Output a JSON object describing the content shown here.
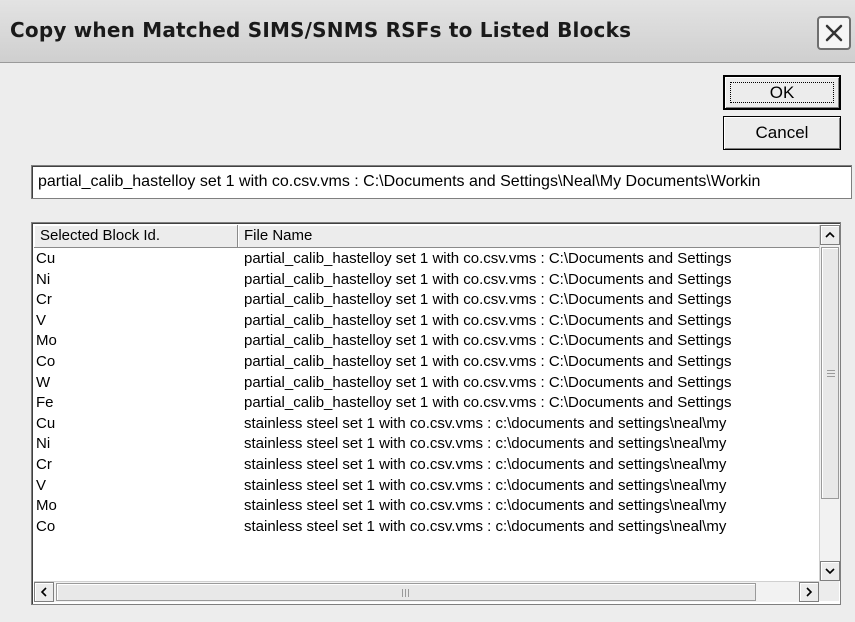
{
  "window": {
    "title": "Copy when Matched SIMS/SNMS RSFs to Listed Blocks"
  },
  "buttons": {
    "ok_label": "OK",
    "cancel_label": "Cancel"
  },
  "path_field": {
    "value": "partial_calib_hastelloy set 1 with co.csv.vms : C:\\Documents and Settings\\Neal\\My Documents\\Workin"
  },
  "list": {
    "columns": [
      "Selected Block Id.",
      "File Name"
    ],
    "rows": [
      {
        "block": "Cu",
        "file": "partial_calib_hastelloy set 1 with co.csv.vms : C:\\Documents and Settings"
      },
      {
        "block": "Ni",
        "file": "partial_calib_hastelloy set 1 with co.csv.vms : C:\\Documents and Settings"
      },
      {
        "block": "Cr",
        "file": "partial_calib_hastelloy set 1 with co.csv.vms : C:\\Documents and Settings"
      },
      {
        "block": "V",
        "file": "partial_calib_hastelloy set 1 with co.csv.vms : C:\\Documents and Settings"
      },
      {
        "block": "Mo",
        "file": "partial_calib_hastelloy set 1 with co.csv.vms : C:\\Documents and Settings"
      },
      {
        "block": "Co",
        "file": "partial_calib_hastelloy set 1 with co.csv.vms : C:\\Documents and Settings"
      },
      {
        "block": "W",
        "file": "partial_calib_hastelloy set 1 with co.csv.vms : C:\\Documents and Settings"
      },
      {
        "block": "Fe",
        "file": "partial_calib_hastelloy set 1 with co.csv.vms : C:\\Documents and Settings"
      },
      {
        "block": "Cu",
        "file": "stainless steel set 1 with co.csv.vms : c:\\documents and settings\\neal\\my"
      },
      {
        "block": "Ni",
        "file": "stainless steel set 1 with co.csv.vms : c:\\documents and settings\\neal\\my"
      },
      {
        "block": "Cr",
        "file": "stainless steel set 1 with co.csv.vms : c:\\documents and settings\\neal\\my"
      },
      {
        "block": "V",
        "file": "stainless steel set 1 with co.csv.vms : c:\\documents and settings\\neal\\my"
      },
      {
        "block": "Mo",
        "file": "stainless steel set 1 with co.csv.vms : c:\\documents and settings\\neal\\my"
      },
      {
        "block": "Co",
        "file": "stainless steel set 1 with co.csv.vms : c:\\documents and settings\\neal\\my"
      }
    ]
  },
  "icons": {
    "close": "close-icon",
    "scroll_up": "arrow-up-icon",
    "scroll_down": "arrow-down-icon",
    "scroll_left": "arrow-left-icon",
    "scroll_right": "arrow-right-icon"
  }
}
